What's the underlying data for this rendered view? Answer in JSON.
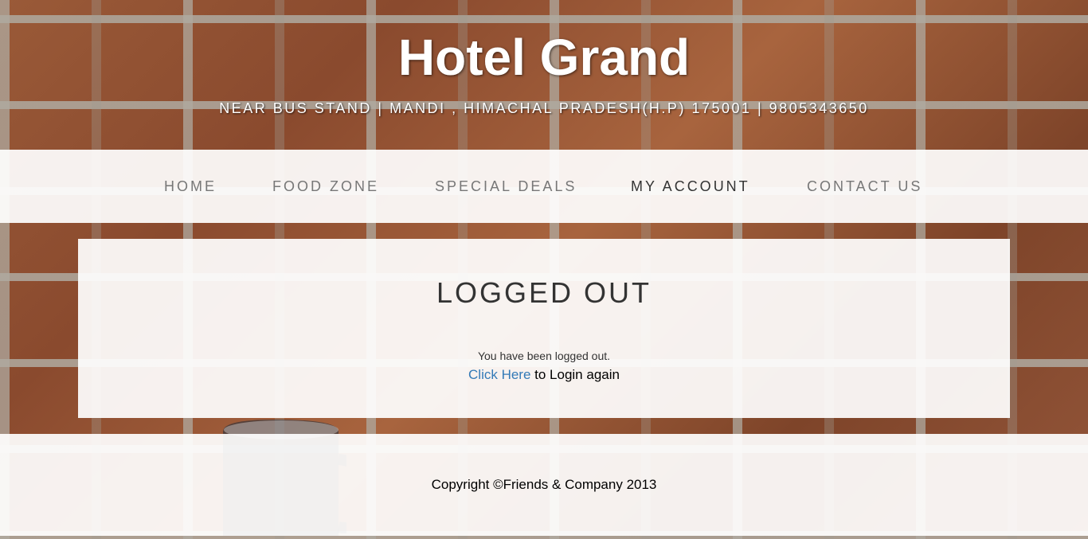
{
  "header": {
    "title": "Hotel Grand",
    "subtitle": "NEAR BUS STAND | MANDI , HIMACHAL PRADESH(H.P) 175001 | 9805343650"
  },
  "nav": {
    "items": [
      {
        "label": "HOME"
      },
      {
        "label": "FOOD ZONE"
      },
      {
        "label": "SPECIAL DEALS"
      },
      {
        "label": "MY ACCOUNT"
      },
      {
        "label": "CONTACT US"
      }
    ],
    "active": "MY ACCOUNT"
  },
  "content": {
    "title": "LOGGED OUT",
    "message": "You have been logged out.",
    "login_link_label": "Click Here",
    "login_suffix": " to Login again"
  },
  "footer": {
    "copyright": "Copyright ©Friends & Company 2013"
  },
  "colors": {
    "link": "#337ab7",
    "nav_text": "#777777",
    "nav_active_text": "#333333",
    "panel_background": "rgba(255,255,255,0.92)"
  }
}
